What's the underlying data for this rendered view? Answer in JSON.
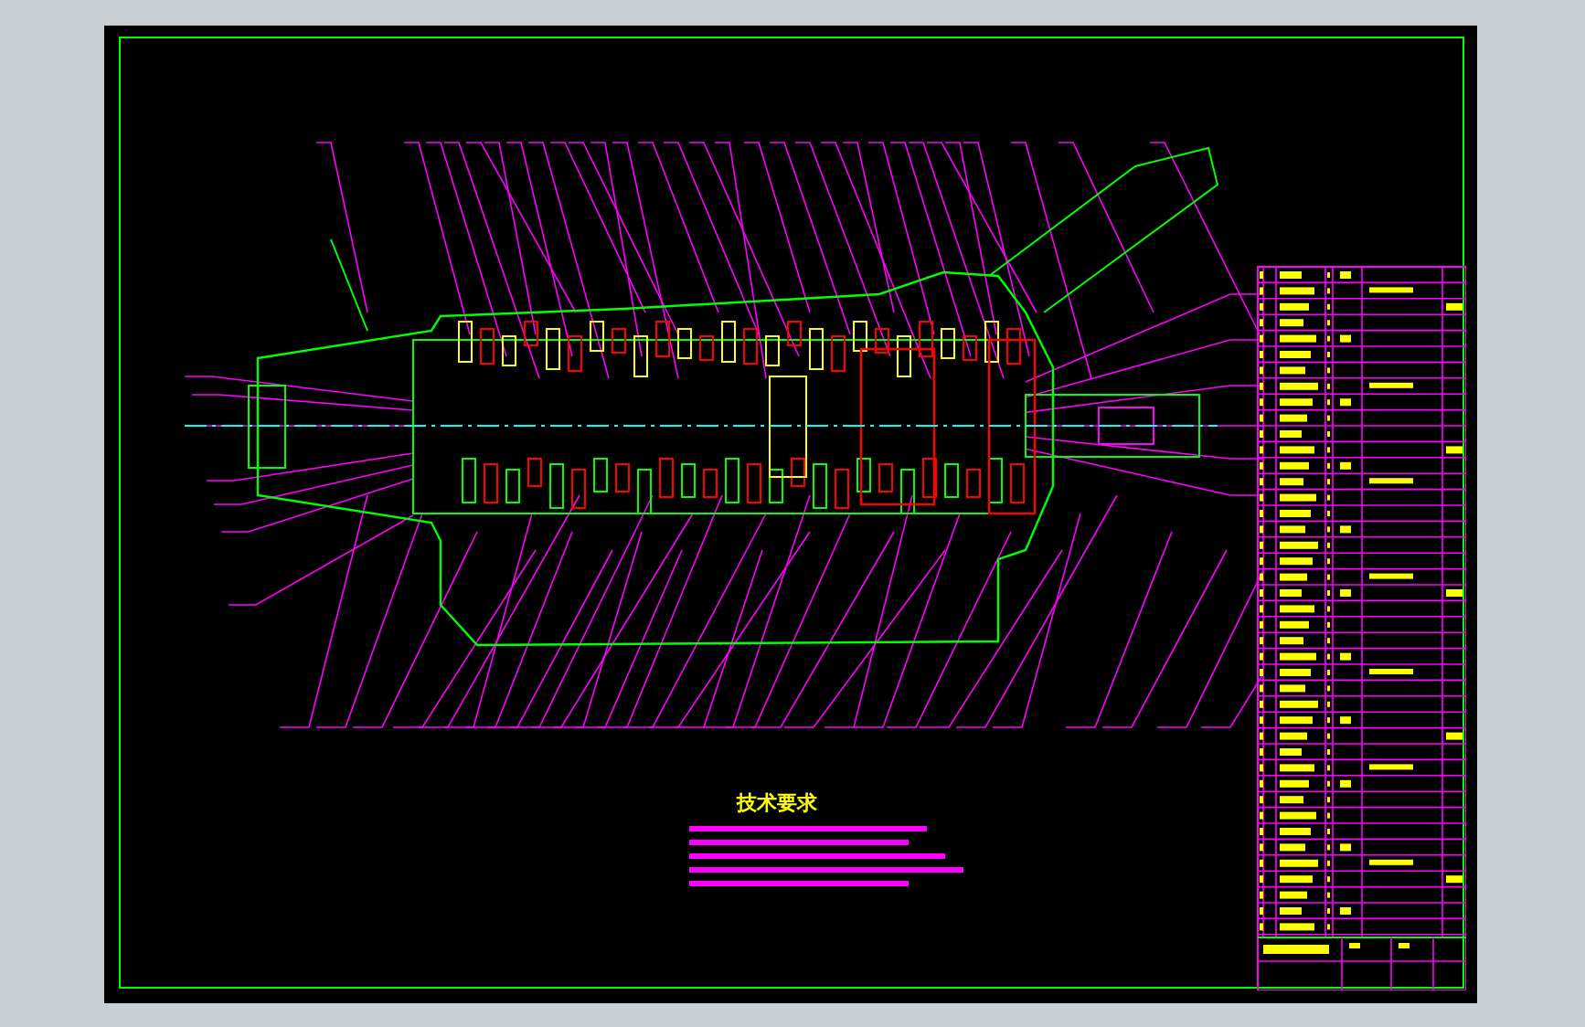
{
  "sheet": {
    "notes": {
      "title": "技术要求"
    }
  }
}
